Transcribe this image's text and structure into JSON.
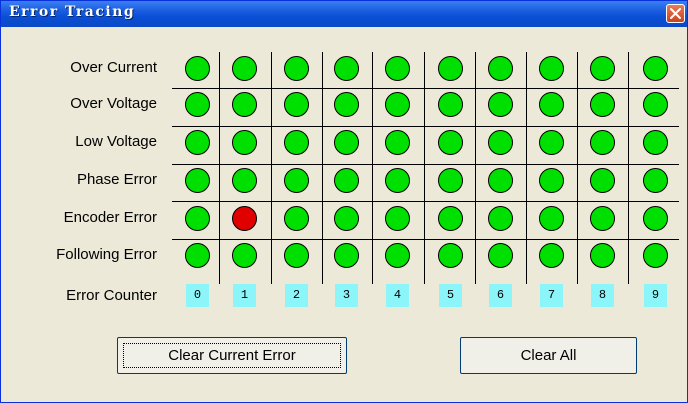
{
  "window": {
    "title": "Error Tracing",
    "close_icon": "close-icon"
  },
  "rows": [
    {
      "label": "Over Current",
      "status": [
        "green",
        "green",
        "green",
        "green",
        "green",
        "green",
        "green",
        "green",
        "green",
        "green"
      ]
    },
    {
      "label": "Over Voltage",
      "status": [
        "green",
        "green",
        "green",
        "green",
        "green",
        "green",
        "green",
        "green",
        "green",
        "green"
      ]
    },
    {
      "label": "Low Voltage",
      "status": [
        "green",
        "green",
        "green",
        "green",
        "green",
        "green",
        "green",
        "green",
        "green",
        "green"
      ]
    },
    {
      "label": "Phase Error",
      "status": [
        "green",
        "green",
        "green",
        "green",
        "green",
        "green",
        "green",
        "green",
        "green",
        "green"
      ]
    },
    {
      "label": "Encoder Error",
      "status": [
        "green",
        "red",
        "green",
        "green",
        "green",
        "green",
        "green",
        "green",
        "green",
        "green"
      ]
    },
    {
      "label": "Following Error",
      "status": [
        "green",
        "green",
        "green",
        "green",
        "green",
        "green",
        "green",
        "green",
        "green",
        "green"
      ]
    }
  ],
  "counter": {
    "label": "Error Counter",
    "values": [
      "0",
      "1",
      "2",
      "3",
      "4",
      "5",
      "6",
      "7",
      "8",
      "9"
    ]
  },
  "buttons": {
    "clear_current": "Clear Current Error",
    "clear_all": "Clear All"
  },
  "colors": {
    "green": "#00E000",
    "red": "#E00000",
    "counter_bg": "#8CF5FA"
  }
}
